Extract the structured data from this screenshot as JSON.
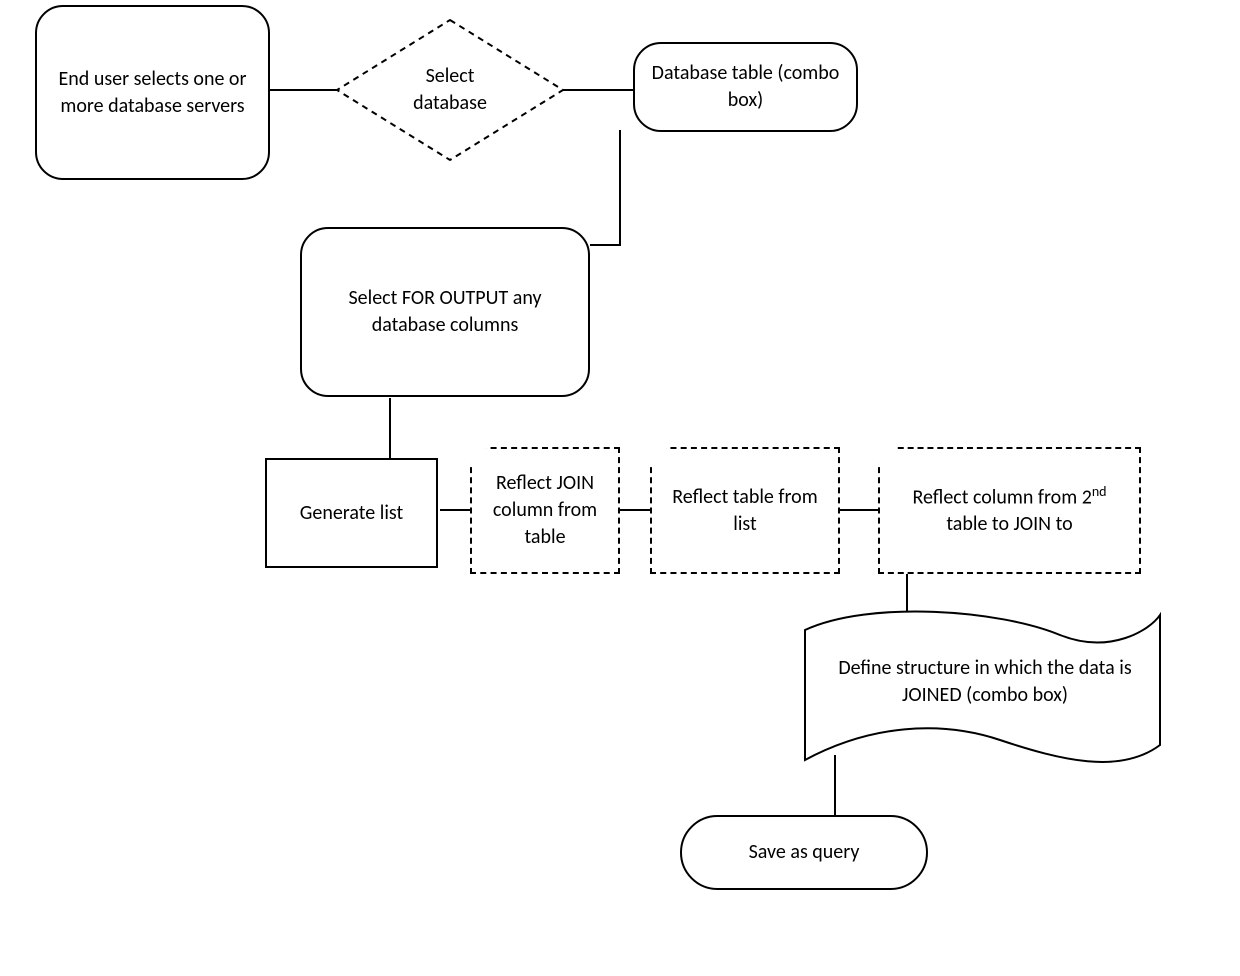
{
  "nodes": {
    "select_servers": "End user selects one or more database servers",
    "select_database": "Select database",
    "database_table": "Database table (combo box)",
    "select_columns": "Select FOR OUTPUT any database columns",
    "generate_list": "Generate list",
    "reflect_join_column": "Reflect JOIN column from table",
    "reflect_table": "Reflect table from list",
    "reflect_column_2nd_a": "Reflect column from 2",
    "reflect_column_2nd_sup": "nd",
    "reflect_column_2nd_b": " table to JOIN to",
    "define_structure": "Define structure in which the data is JOINED (combo box)",
    "save_query": "Save as query"
  }
}
